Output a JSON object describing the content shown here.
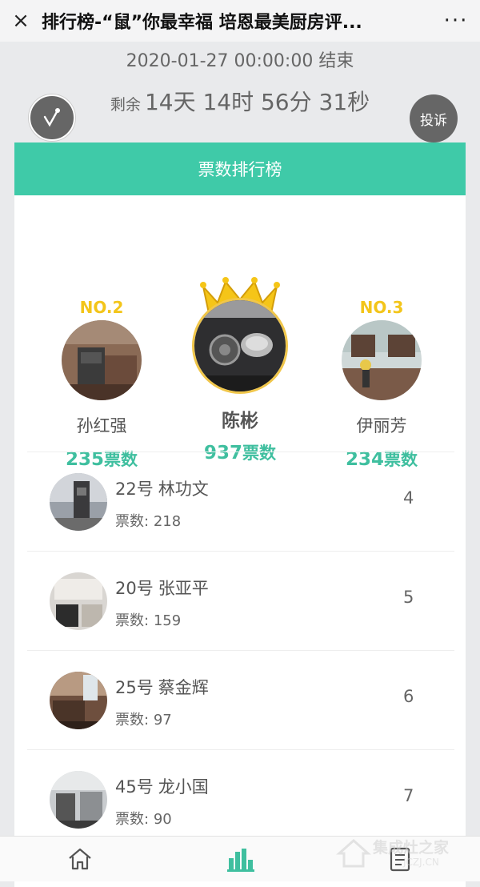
{
  "topbar": {
    "close_icon": "×",
    "title": "排行榜-“鼠”你最幸福 培恩最美厨房评...",
    "more_icon": "···"
  },
  "header": {
    "end_time": "2020-01-27 00:00:00 结束",
    "remaining_label": "剩余",
    "remaining_value": "14天 14时 56分 31秒",
    "complaint_label": "投诉"
  },
  "ranking": {
    "title": "票数排行榜",
    "podium": [
      {
        "rank": "NO.2",
        "name": "孙红强",
        "votes": "235",
        "unit": "票数"
      },
      {
        "rank": "",
        "name": "陈彬",
        "votes": "937",
        "unit": "票数"
      },
      {
        "rank": "NO.3",
        "name": "伊丽芳",
        "votes": "234",
        "unit": "票数"
      }
    ],
    "list": [
      {
        "no": "22号",
        "name": "林功文",
        "votes_label": "票数:",
        "votes": "218",
        "rank": "4"
      },
      {
        "no": "20号",
        "name": "张亚平",
        "votes_label": "票数:",
        "votes": "159",
        "rank": "5"
      },
      {
        "no": "25号",
        "name": "蔡金辉",
        "votes_label": "票数:",
        "votes": "97",
        "rank": "6"
      },
      {
        "no": "45号",
        "name": "龙小国",
        "votes_label": "票数:",
        "votes": "90",
        "rank": "7"
      }
    ]
  },
  "watermark": {
    "text": "集成灶之家",
    "url": "JCZJ.CN"
  },
  "colors": {
    "accent": "#3fcaa8",
    "gold": "#f3c51a",
    "vote_green": "#3fbf9f"
  }
}
